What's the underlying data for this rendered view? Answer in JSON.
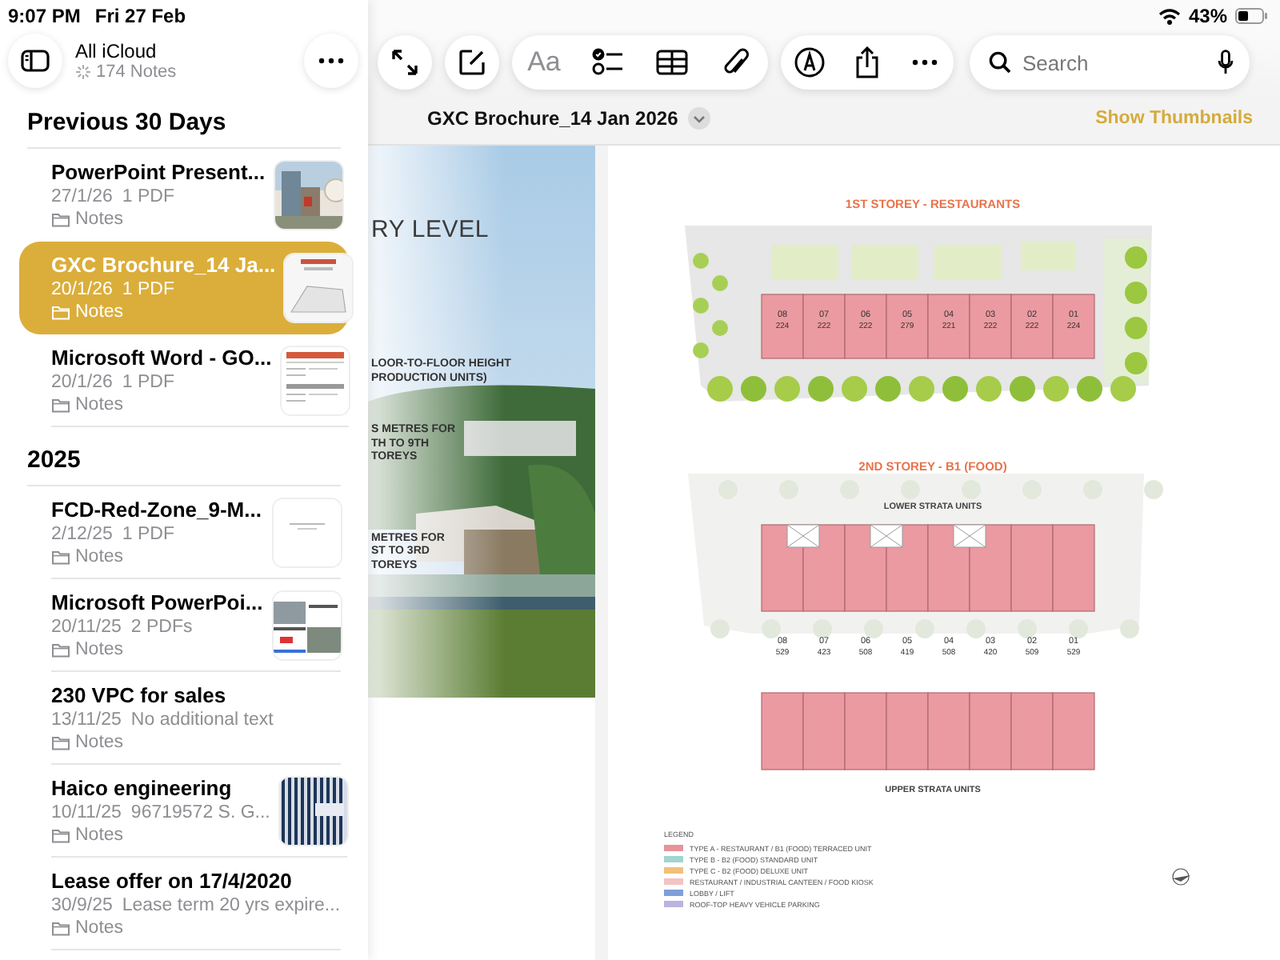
{
  "status_bar": {
    "time": "9:07 PM",
    "date": "Fri 27 Feb",
    "battery": "43%"
  },
  "sidebar": {
    "account": "All iCloud",
    "count": "174 Notes",
    "sections": [
      {
        "title": "Previous 30 Days",
        "notes": [
          {
            "title": "PowerPoint Present...",
            "date": "27/1/26",
            "summary": "1 PDF",
            "folder": "Notes",
            "selected": false
          },
          {
            "title": "GXC Brochure_14 Ja...",
            "date": "20/1/26",
            "summary": "1 PDF",
            "folder": "Notes",
            "thumbnail": {
              "kind": "page"
            },
            "selected": true
          },
          {
            "title": "Microsoft Word - GO...",
            "date": "20/1/26",
            "summary": "1 PDF",
            "folder": "Notes",
            "thumbnail": {
              "kind": "form"
            },
            "selected": false
          }
        ]
      },
      {
        "title": "2025",
        "notes": [
          {
            "title": "FCD-Red-Zone_9-M...",
            "date": "2/12/25",
            "summary": "1 PDF",
            "folder": "Notes",
            "thumbnail": {
              "kind": "blank"
            },
            "selected": false
          },
          {
            "title": "Microsoft PowerPoi...",
            "date": "20/11/25",
            "summary": "2 PDFs",
            "folder": "Notes",
            "thumbnail": {
              "kind": "slides"
            },
            "selected": false
          },
          {
            "title": "230 VPC for sales",
            "date": "13/11/25",
            "summary": "No additional text",
            "folder": "Notes",
            "selected": false
          },
          {
            "title": "Haico engineering",
            "date": "10/11/25",
            "summary": "96719572 S. G...",
            "folder": "Notes",
            "thumbnail": {
              "kind": "stripes"
            },
            "selected": false
          },
          {
            "title": "Lease offer on 17/4/2020",
            "date": "30/9/25",
            "summary": "Lease term 20 yrs expire...",
            "folder": "Notes",
            "selected": false
          }
        ]
      }
    ]
  },
  "toolbar": {
    "format_label": "Aa",
    "search": {
      "placeholder": "Search"
    }
  },
  "document": {
    "title": "GXC Brochure_14 Jan 2026",
    "thumbnails_link": "Show Thumbnails",
    "left_page": {
      "heading": "RY LEVEL",
      "callouts": [
        [
          "LOOR-TO-FLOOR HEIGHT",
          "PRODUCTION UNITS)"
        ],
        [
          "S METRES FOR",
          "TH TO 9TH",
          "TOREYS"
        ],
        [
          "METRES FOR",
          "ST TO 3RD",
          "TOREYS"
        ]
      ]
    },
    "right_page": {
      "plans": [
        {
          "kind": "ground",
          "title": "1ST STOREY - RESTAURANTS",
          "units": [
            {
              "number": "08",
              "area": "224"
            },
            {
              "number": "07",
              "area": "222"
            },
            {
              "number": "06",
              "area": "222"
            },
            {
              "number": "05",
              "area": "279"
            },
            {
              "number": "04",
              "area": "221"
            },
            {
              "number": "03",
              "area": "222"
            },
            {
              "number": "02",
              "area": "222"
            },
            {
              "number": "01",
              "area": "224"
            }
          ]
        },
        {
          "kind": "strata",
          "title": "2ND STOREY - B1 (FOOD)",
          "top_label": "LOWER STRATA UNITS",
          "bottom_label": "UPPER STRATA UNITS",
          "units": [
            {
              "number": "08",
              "area": "529"
            },
            {
              "number": "07",
              "area": "423"
            },
            {
              "number": "06",
              "area": "508"
            },
            {
              "number": "05",
              "area": "419"
            },
            {
              "number": "04",
              "area": "508"
            },
            {
              "number": "03",
              "area": "420"
            },
            {
              "number": "02",
              "area": "509"
            },
            {
              "number": "01",
              "area": "529"
            }
          ]
        }
      ],
      "legend": {
        "title": "LEGEND",
        "items": [
          {
            "label": "TYPE A - RESTAURANT / B1 (FOOD) TERRACED UNIT",
            "color": "#e8939a"
          },
          {
            "label": "TYPE B - B2 (FOOD) STANDARD UNIT",
            "color": "#9fd6cf"
          },
          {
            "label": "TYPE C - B2 (FOOD) DELUXE UNIT",
            "color": "#f2c07a"
          },
          {
            "label": "RESTAURANT / INDUSTRIAL CANTEEN / FOOD KIOSK",
            "color": "#f4c2c2"
          },
          {
            "label": "LOBBY / LIFT",
            "color": "#7f9fd8"
          },
          {
            "label": "ROOF-TOP HEAVY VEHICLE PARKING",
            "color": "#bab5dd"
          }
        ]
      }
    }
  }
}
